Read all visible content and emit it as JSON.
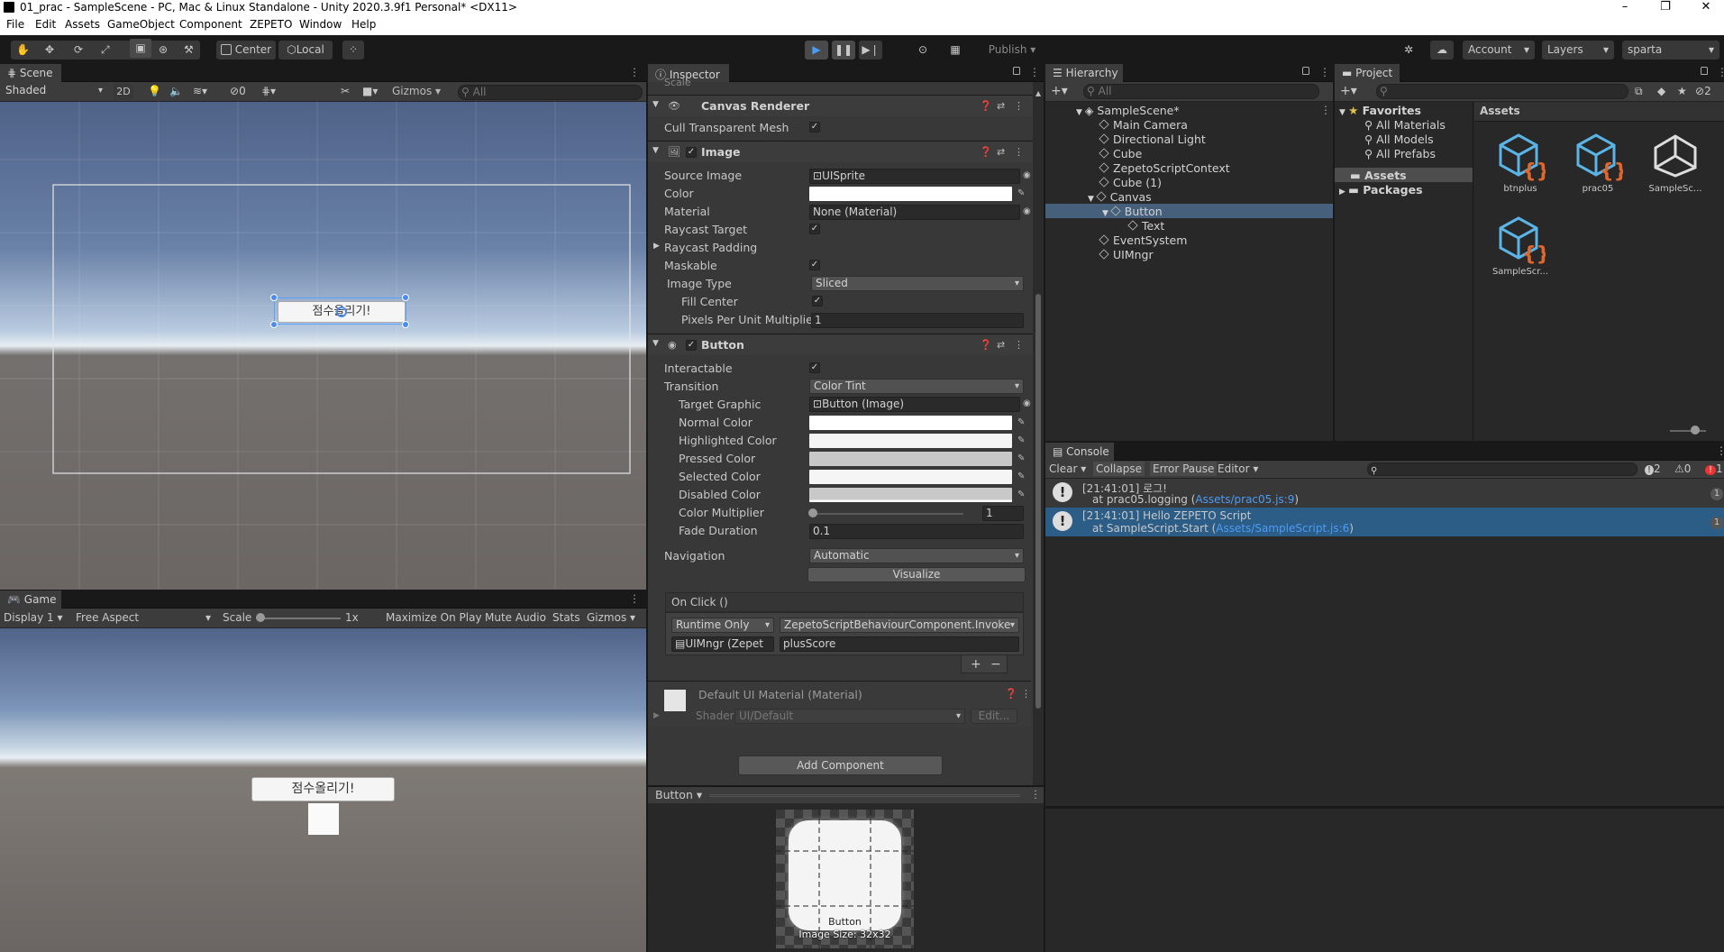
{
  "window": {
    "title": "01_prac - SampleScene - PC, Mac & Linux Standalone - Unity 2020.3.9f1 Personal* <DX11>",
    "minimize": "–",
    "maximize": "❐",
    "close": "✕"
  },
  "menu": [
    "File",
    "Edit",
    "Assets",
    "GameObject",
    "Component",
    "ZEPETO",
    "Window",
    "Help"
  ],
  "toolbar": {
    "center_label": "Center",
    "local_label": "Local",
    "publish_label": "Publish",
    "account_label": "Account",
    "layers_label": "Layers",
    "layout_label": "sparta"
  },
  "scene": {
    "tab_label": "Scene",
    "shading_mode": "Shaded",
    "mode_2d": "2D",
    "hidden_count": "0",
    "gizmos_label": "Gizmos",
    "search_placeholder": "All",
    "button_text": "점수올리기!"
  },
  "game": {
    "tab_label": "Game",
    "display": "Display 1",
    "aspect": "Free Aspect",
    "scale_label": "Scale",
    "scale_value": "1x",
    "maximize_on_play": "Maximize On Play",
    "mute_audio": "Mute Audio",
    "stats": "Stats",
    "gizmos": "Gizmos",
    "button_text": "점수올리기!"
  },
  "inspector": {
    "tab_label": "Inspector",
    "clipped_row": "Scale",
    "canvas_renderer": {
      "title": "Canvas Renderer",
      "cull_label": "Cull Transparent Mesh"
    },
    "image": {
      "title": "Image",
      "source_image_label": "Source Image",
      "source_image_value": "UISprite",
      "color_label": "Color",
      "material_label": "Material",
      "material_value": "None (Material)",
      "raycast_target_label": "Raycast Target",
      "raycast_padding_label": "Raycast Padding",
      "maskable_label": "Maskable",
      "image_type_label": "Image Type",
      "image_type_value": "Sliced",
      "fill_center_label": "Fill Center",
      "ppu_label": "Pixels Per Unit Multiplier",
      "ppu_value": "1"
    },
    "button": {
      "title": "Button",
      "interactable_label": "Interactable",
      "transition_label": "Transition",
      "transition_value": "Color Tint",
      "target_graphic_label": "Target Graphic",
      "target_graphic_value": "Button (Image)",
      "normal_color_label": "Normal Color",
      "highlighted_color_label": "Highlighted Color",
      "pressed_color_label": "Pressed Color",
      "selected_color_label": "Selected Color",
      "disabled_color_label": "Disabled Color",
      "color_multiplier_label": "Color Multiplier",
      "color_multiplier_value": "1",
      "color_multiplier_fraction": 0.0,
      "fade_duration_label": "Fade Duration",
      "fade_duration_value": "0.1",
      "navigation_label": "Navigation",
      "navigation_value": "Automatic",
      "visualize_label": "Visualize",
      "onclick_label": "On Click ()",
      "runtime_value": "Runtime Only",
      "function_value": "ZepetoScriptBehaviourComponent.Invoke",
      "object_value": "UIMngr (Zepet",
      "argument_value": "plusScore",
      "plus": "+",
      "minus": "−"
    },
    "material": {
      "title": "Default UI Material (Material)",
      "shader_label": "Shader",
      "shader_value": "UI/Default",
      "edit_label": "Edit..."
    },
    "add_component_label": "Add Component",
    "preview": {
      "title": "Button",
      "caption_name": "Button",
      "caption_size": "Image Size: 32x32"
    }
  },
  "hierarchy": {
    "tab_label": "Hierarchy",
    "search_placeholder": "All",
    "items": [
      {
        "label": "SampleScene*",
        "level": 0
      },
      {
        "label": "Main Camera",
        "level": 1
      },
      {
        "label": "Directional Light",
        "level": 1
      },
      {
        "label": "Cube",
        "level": 1
      },
      {
        "label": "ZepetoScriptContext",
        "level": 1
      },
      {
        "label": "Cube (1)",
        "level": 1
      },
      {
        "label": "Canvas",
        "level": 1
      },
      {
        "label": "Button",
        "level": 2
      },
      {
        "label": "Text",
        "level": 3
      },
      {
        "label": "EventSystem",
        "level": 1
      },
      {
        "label": "UIMngr",
        "level": 1
      }
    ]
  },
  "project": {
    "tab_label": "Project",
    "favorites_label": "Favorites",
    "favorites": [
      "All Materials",
      "All Models",
      "All Prefabs"
    ],
    "assets_folder": "Assets",
    "packages_folder": "Packages",
    "breadcrumb": "Assets",
    "hidden_count": "2",
    "assets": [
      {
        "name": "btnplus",
        "icon": "script-icon"
      },
      {
        "name": "prac05",
        "icon": "script-icon"
      },
      {
        "name": "SampleSc...",
        "icon": "unity-icon"
      },
      {
        "name": "SampleScr...",
        "icon": "script-icon"
      }
    ]
  },
  "console": {
    "tab_label": "Console",
    "clear": "Clear",
    "collapse": "Collapse",
    "error_pause": "Error Pause",
    "editor": "Editor",
    "log_count": "2",
    "warn_count": "0",
    "error_count": "1",
    "entries": [
      {
        "time": "[21:41:01] 로그!",
        "trace_prefix": "at prac05.logging (",
        "trace_link": "Assets/prac05.js:9",
        "trace_suffix": ")",
        "count": "1"
      },
      {
        "time": "[21:41:01] Hello ZEPETO Script",
        "trace_prefix": "at SampleScript.Start (",
        "trace_link": "Assets/SampleScript.js:6",
        "trace_suffix": ")",
        "count": "1"
      }
    ]
  },
  "colors": {
    "accent": "#2c5d87",
    "link": "#4c9bf5",
    "panel": "#282828",
    "header": "#3c3c3c"
  }
}
